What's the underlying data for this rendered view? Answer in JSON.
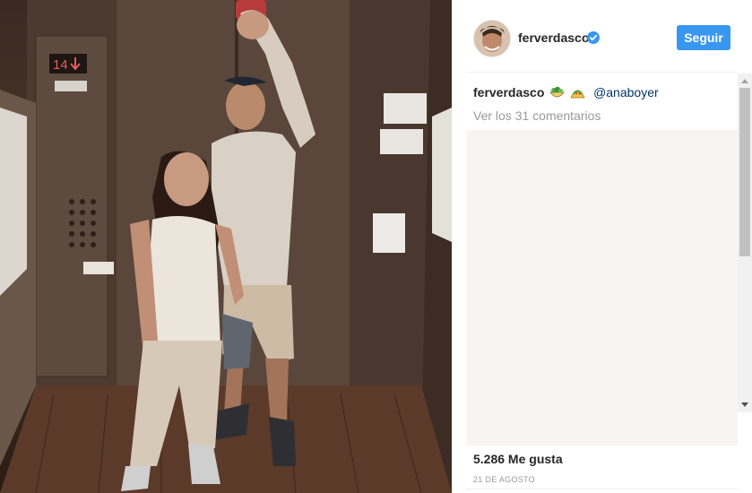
{
  "post": {
    "username": "ferverdasco",
    "follow_label": "Seguir",
    "caption_user": "ferverdasco",
    "caption_emojis": [
      "🥗",
      "🌮"
    ],
    "mention": "@anaboyer",
    "view_comments": "Ver los 31 comentarios",
    "likes": "5.286 Me gusta",
    "date": "21 DE AGOSTO"
  },
  "photo": {
    "floor_display": "14",
    "floor_direction": "down-arrow"
  },
  "colors": {
    "follow_button": "#3897f0",
    "mention": "#003569",
    "muted_text": "#999999",
    "verified_badge": "#3897f0"
  },
  "icons": [
    "verified-badge-icon",
    "scroll-up-arrow-icon",
    "scroll-down-arrow-icon"
  ]
}
